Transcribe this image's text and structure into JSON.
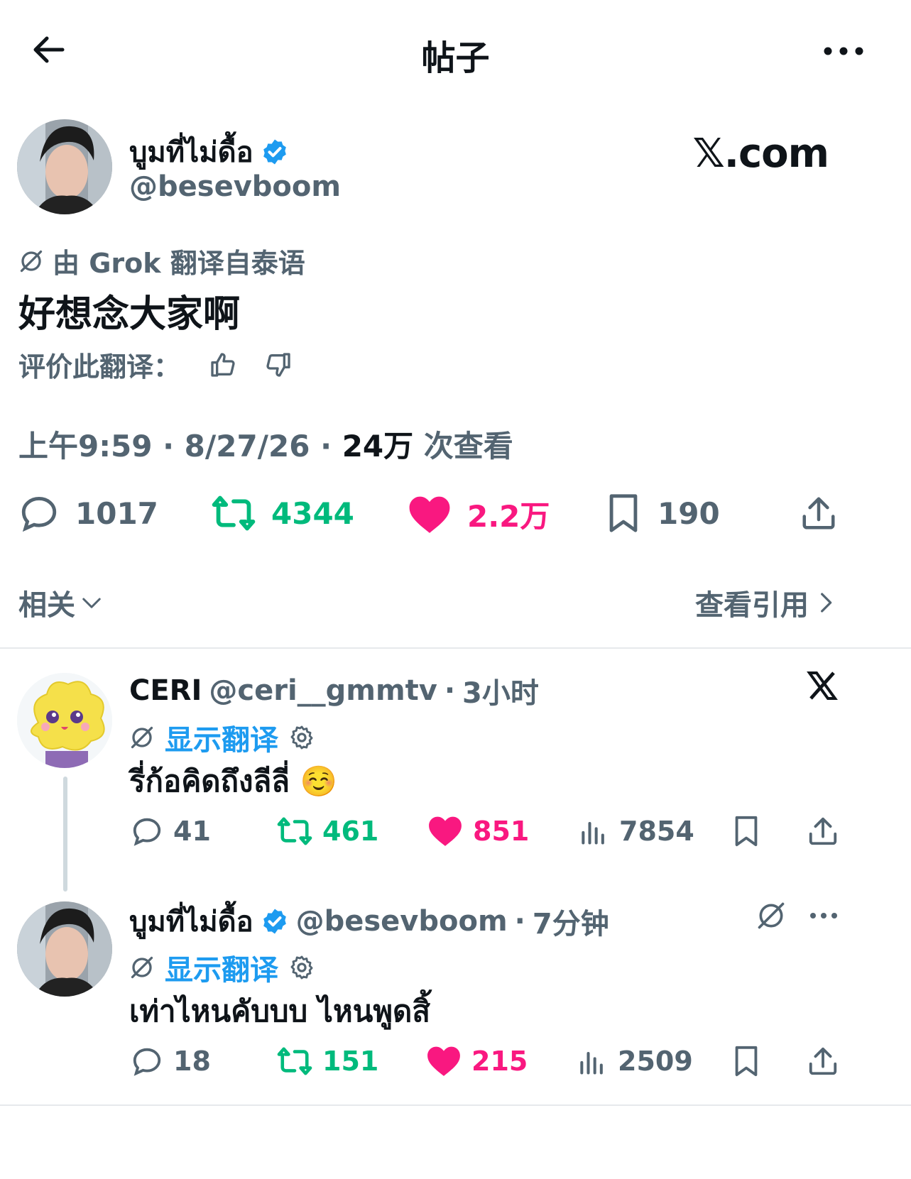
{
  "header": {
    "title": "帖子",
    "back_icon": "arrow-left-icon",
    "more_icon": "more-icon"
  },
  "post": {
    "author_name": "บูมที่ไม่ดื้อ",
    "author_handle": "@besevboom",
    "verified": true,
    "watermark": "𝕏.com",
    "translation_note": "由 Grok 翻译自泰语",
    "text": "好想念大家啊",
    "rate_label": "评价此翻译：",
    "time": "上午9:59",
    "date": "8/27/26",
    "views_count": "24万",
    "views_label": "次查看",
    "stats": {
      "replies": "1017",
      "reposts": "4344",
      "likes": "2.2万",
      "bookmarks": "190"
    },
    "related_label": "相关",
    "view_quotes_label": "查看引用"
  },
  "replies": [
    {
      "name": "CERI",
      "handle": "@ceri__gmmtv",
      "time": "3小时",
      "show_translation": "显示翻译",
      "text": "รี่ก้อคิดถึงลีลี่ ☺️",
      "stats": {
        "replies": "41",
        "reposts": "461",
        "likes": "851",
        "views": "7854"
      }
    },
    {
      "name": "บูมที่ไม่ดื้อ",
      "handle": "@besevboom",
      "time": "7分钟",
      "show_translation": "显示翻译",
      "text": "เท่าไหนคับบบ ไหนพูดสิ้",
      "stats": {
        "replies": "18",
        "reposts": "151",
        "likes": "215",
        "views": "2509"
      }
    }
  ],
  "colors": {
    "accent": "#1d9bf0",
    "repost": "#00ba7c",
    "like": "#f91880",
    "secondary": "#536471"
  }
}
